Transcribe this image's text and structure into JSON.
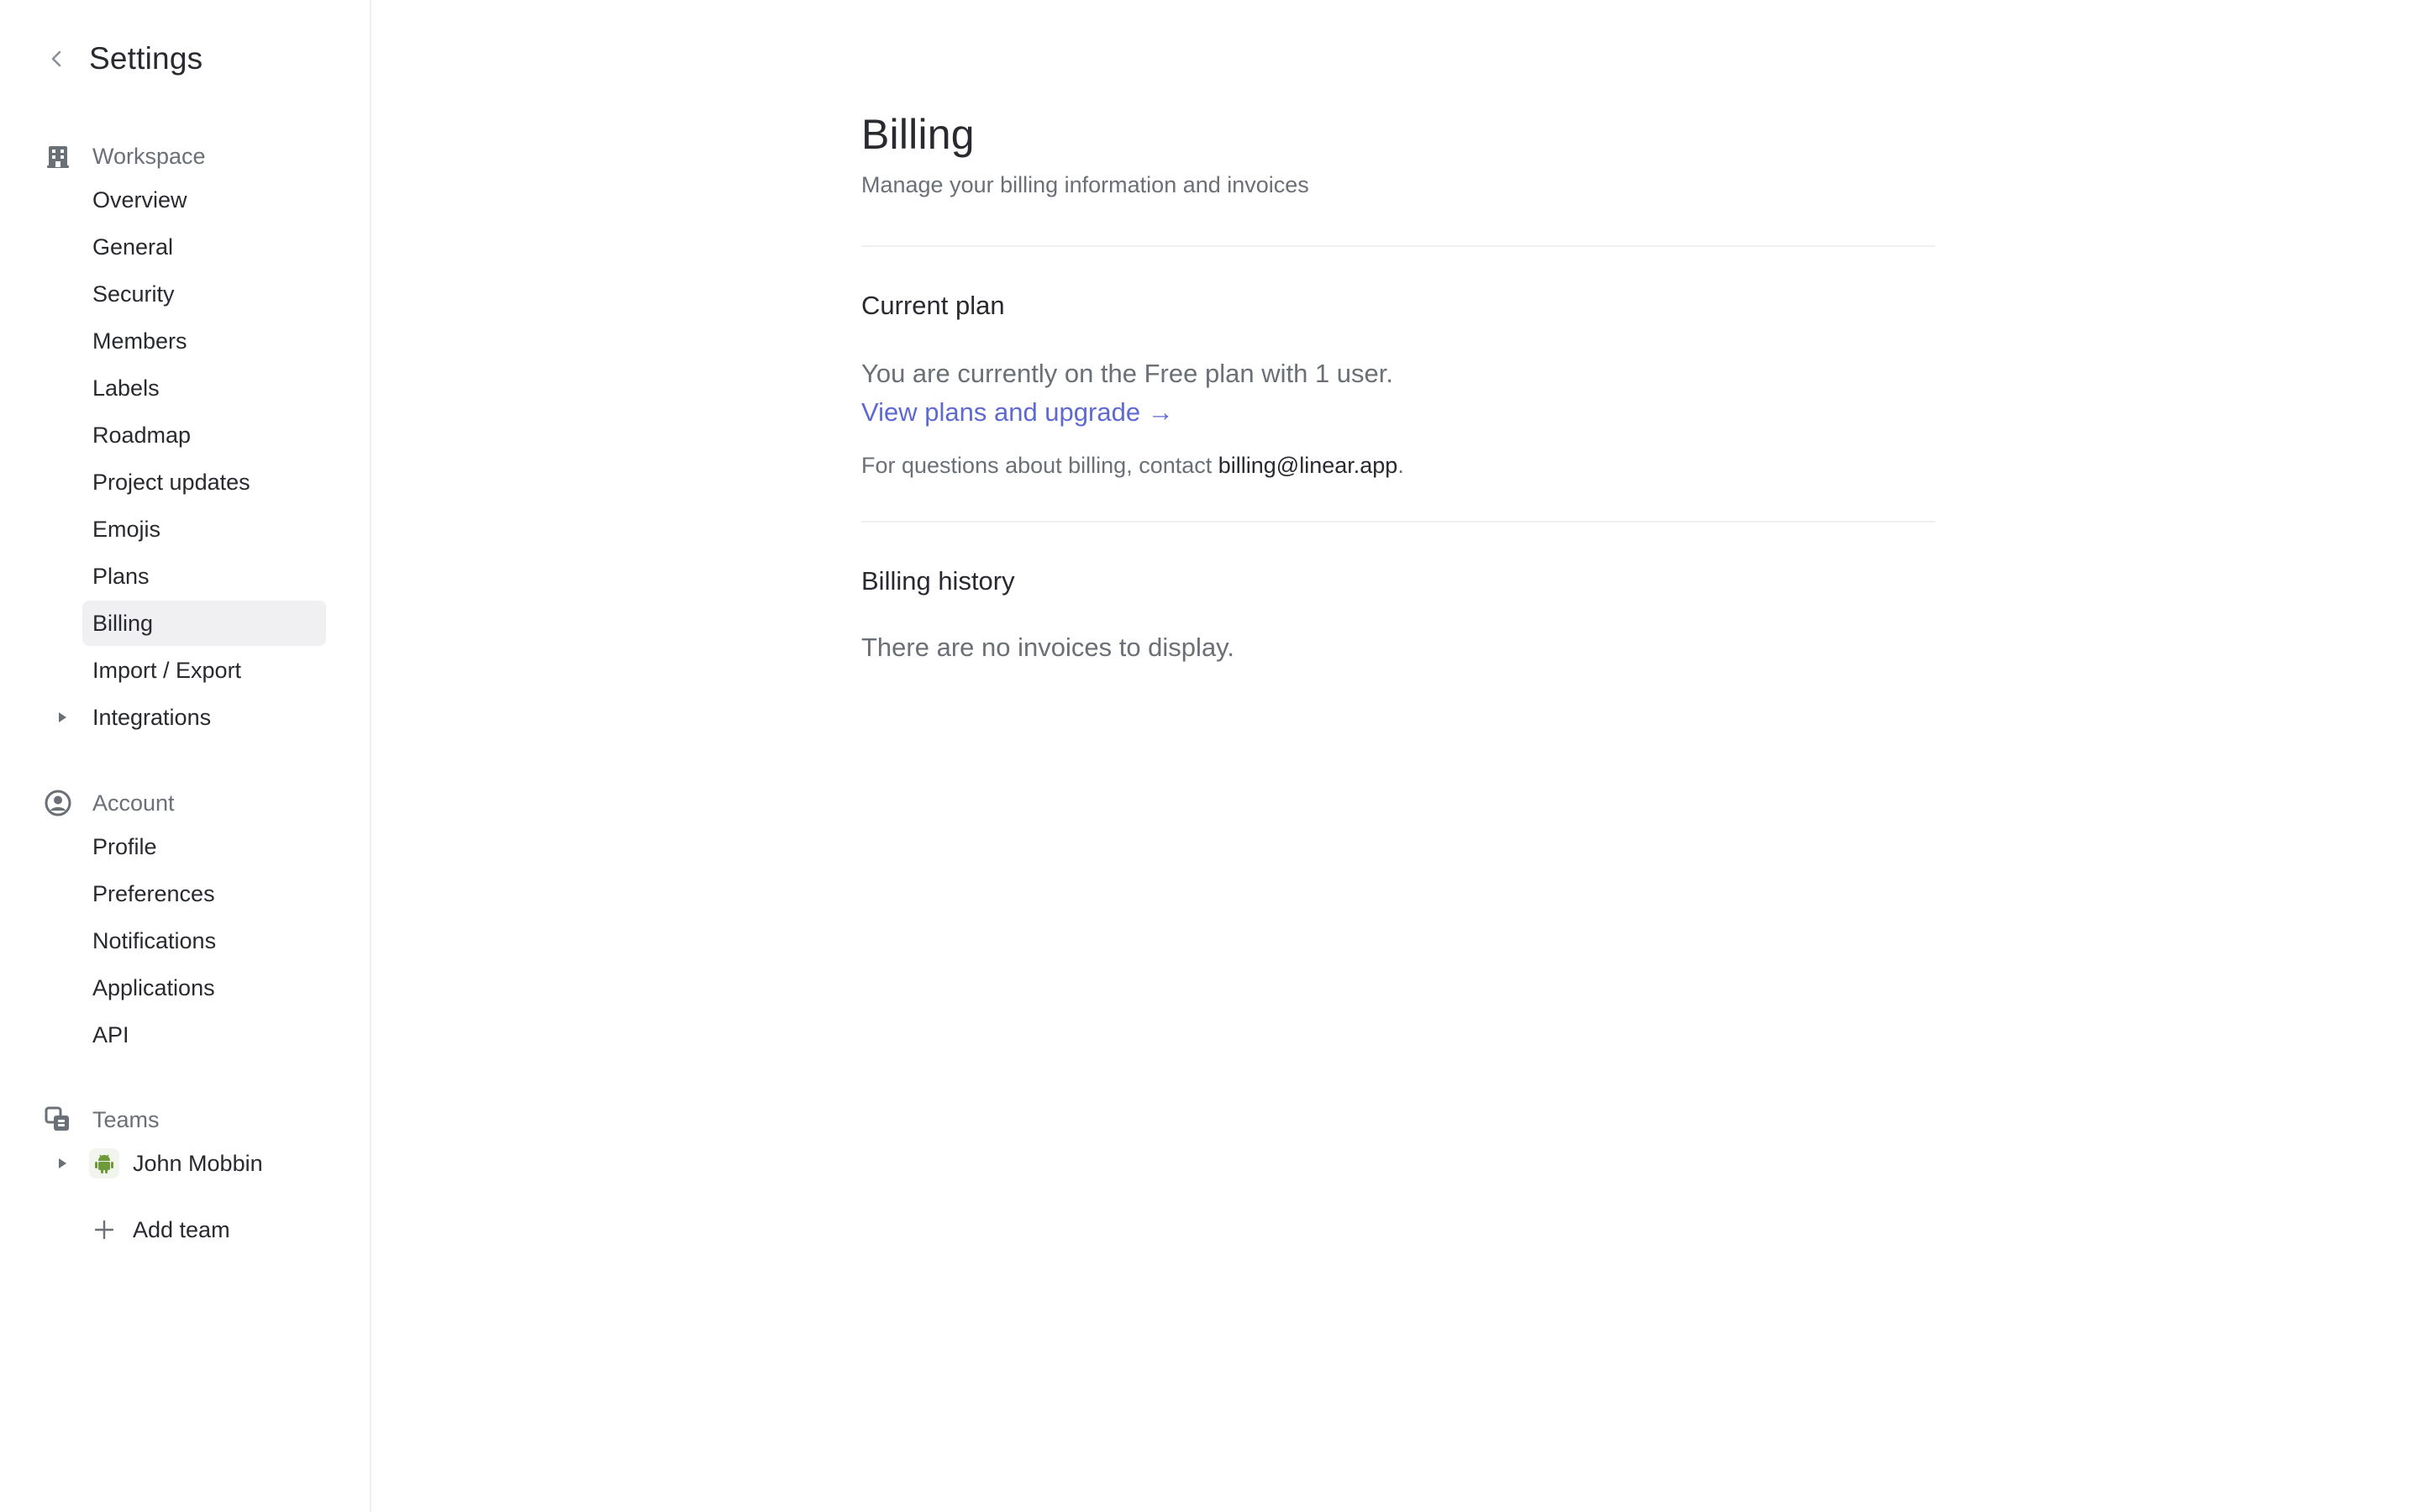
{
  "sidebar": {
    "title": "Settings",
    "workspace": {
      "label": "Workspace",
      "items": [
        {
          "label": "Overview"
        },
        {
          "label": "General"
        },
        {
          "label": "Security"
        },
        {
          "label": "Members"
        },
        {
          "label": "Labels"
        },
        {
          "label": "Roadmap"
        },
        {
          "label": "Project updates"
        },
        {
          "label": "Emojis"
        },
        {
          "label": "Plans"
        },
        {
          "label": "Billing",
          "active": true
        },
        {
          "label": "Import / Export"
        },
        {
          "label": "Integrations",
          "expandable": true
        }
      ]
    },
    "account": {
      "label": "Account",
      "items": [
        {
          "label": "Profile"
        },
        {
          "label": "Preferences"
        },
        {
          "label": "Notifications"
        },
        {
          "label": "Applications"
        },
        {
          "label": "API"
        }
      ]
    },
    "teams": {
      "label": "Teams",
      "items": [
        {
          "label": "John Mobbin",
          "expandable": true
        }
      ],
      "add_label": "Add team"
    }
  },
  "main": {
    "title": "Billing",
    "subtitle": "Manage your billing information and invoices",
    "current_plan": {
      "heading": "Current plan",
      "status": "You are currently on the Free plan with 1 user.",
      "link": "View plans and upgrade →",
      "contact_prefix": "For questions about billing, contact ",
      "contact_email": "billing@linear.app",
      "contact_suffix": "."
    },
    "billing_history": {
      "heading": "Billing history",
      "empty": "There are no invoices to display."
    }
  },
  "colors": {
    "accent": "#5e6ad2",
    "text": "#282a30",
    "muted": "#6b6f76",
    "active_bg": "#f0f0f3",
    "divider": "#eeeff1",
    "team_icon": "#6e9a3a"
  },
  "icons": {
    "back": "chevron-left-icon",
    "workspace": "building-icon",
    "account": "user-circle-icon",
    "teams": "teams-icon",
    "caret": "caret-right-icon",
    "team_avatar": "android-icon",
    "add": "plus-icon"
  }
}
